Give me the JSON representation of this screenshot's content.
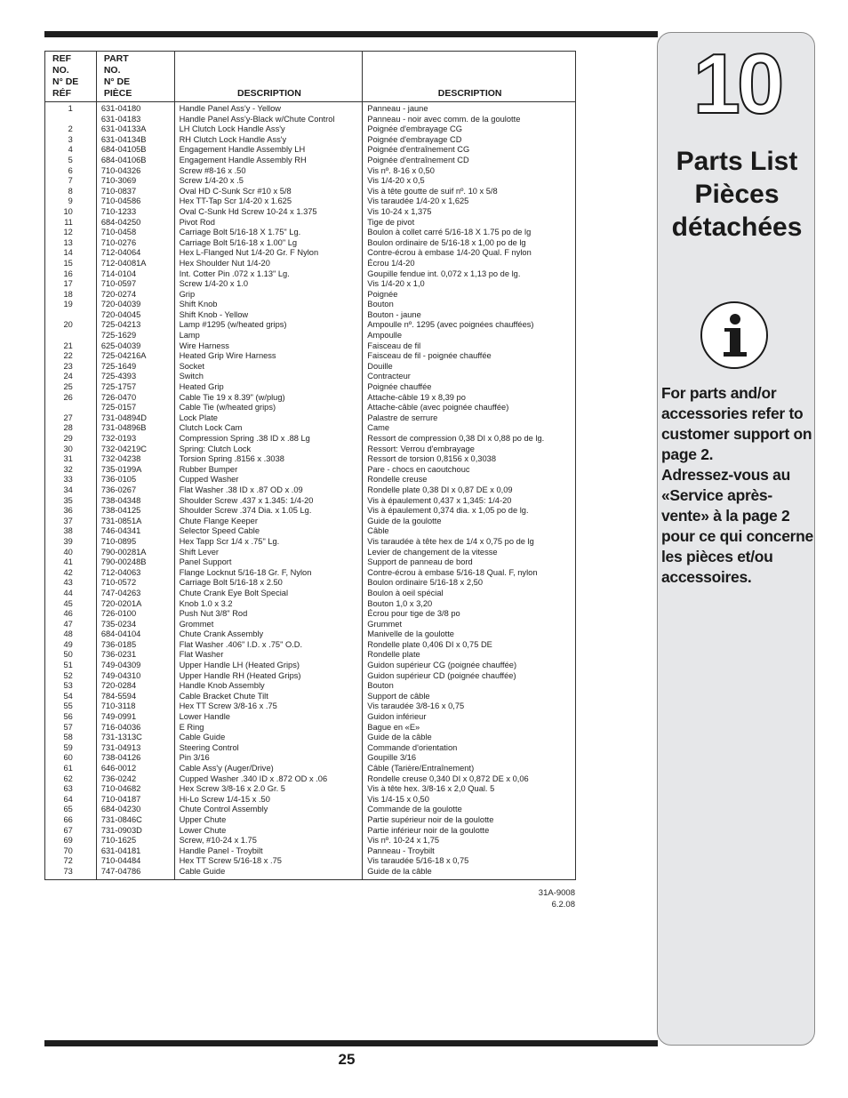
{
  "page": {
    "chapter_number": "10",
    "section_title_en": "Parts List",
    "section_title_fr_1": "Pièces",
    "section_title_fr_2": "détachées",
    "note_en": "For parts and/or accessories refer to customer support on page 2.",
    "note_fr": "Adressez-vous au «Service après-vente» à la page 2 pour ce qui concerne les pièces et/ou accessoires.",
    "page_number": "25",
    "doc_code": "31A-9008",
    "doc_date": "6.2.08",
    "info_icon": "info-icon"
  },
  "table": {
    "headers": {
      "ref": [
        "REF",
        "NO.",
        "N° DE",
        "RÉF"
      ],
      "part": [
        "PART",
        "NO.",
        "N° DE",
        "PIÈCE"
      ],
      "desc_en": "DESCRIPTION",
      "desc_fr": "DESCRIPTION"
    },
    "rows": [
      {
        "ref": "1",
        "part": "631-04180",
        "en": "Handle Panel Ass'y - Yellow",
        "fr": "Panneau - jaune"
      },
      {
        "ref": "",
        "part": "631-04183",
        "en": "Handle Panel Ass'y-Black w/Chute Control",
        "fr": "Panneau - noir avec comm. de la goulotte"
      },
      {
        "ref": "2",
        "part": "631-04133A",
        "en": "LH Clutch Lock Handle Ass'y",
        "fr": "Poignée d'embrayage CG"
      },
      {
        "ref": "3",
        "part": "631-04134B",
        "en": "RH Clutch Lock Handle Ass'y",
        "fr": "Poignée d'embrayage CD"
      },
      {
        "ref": "4",
        "part": "684-04105B",
        "en": "Engagement Handle Assembly LH",
        "fr": "Poignée d'entraînement CG"
      },
      {
        "ref": "5",
        "part": "684-04106B",
        "en": "Engagement Handle Assembly RH",
        "fr": "Poignée d'entraînement CD"
      },
      {
        "ref": "6",
        "part": "710-04326",
        "en": "Screw #8-16 x .50",
        "fr": "Vis nº. 8-16 x 0,50"
      },
      {
        "ref": "7",
        "part": "710-3069",
        "en": "Screw 1/4-20 x .5",
        "fr": "Vis 1/4-20 x 0,5"
      },
      {
        "ref": "8",
        "part": "710-0837",
        "en": "Oval HD C-Sunk Scr #10 x 5/8",
        "fr": "Vis à tête goutte de suif nº. 10 x 5/8"
      },
      {
        "ref": "9",
        "part": "710-04586",
        "en": "Hex TT-Tap Scr 1/4-20 x 1.625",
        "fr": "Vis taraudée 1/4-20 x 1,625"
      },
      {
        "ref": "10",
        "part": "710-1233",
        "en": "Oval C-Sunk Hd Screw 10-24 x 1.375",
        "fr": "Vis 10-24 x 1,375"
      },
      {
        "ref": "11",
        "part": "684-04250",
        "en": "Pivot Rod",
        "fr": "Tige de pivot"
      },
      {
        "ref": "12",
        "part": "710-0458",
        "en": "Carriage Bolt 5/16-18 X 1.75\" Lg.",
        "fr": "Boulon à collet carré 5/16-18 X 1.75 po de lg"
      },
      {
        "ref": "13",
        "part": "710-0276",
        "en": "Carriage Bolt 5/16-18 x 1.00\" Lg",
        "fr": "Boulon ordinaire de 5/16-18 x 1,00 po de lg"
      },
      {
        "ref": "14",
        "part": "712-04064",
        "en": "Hex L-Flanged Nut 1/4-20 Gr. F Nylon",
        "fr": "Contre-écrou à embase 1/4-20 Qual. F nylon"
      },
      {
        "ref": "15",
        "part": "712-04081A",
        "en": "Hex Shoulder Nut 1/4-20",
        "fr": "Écrou 1/4-20"
      },
      {
        "ref": "16",
        "part": "714-0104",
        "en": "Int. Cotter Pin .072 x 1.13\" Lg.",
        "fr": "Goupille fendue int. 0,072 x 1,13 po de lg."
      },
      {
        "ref": "17",
        "part": "710-0597",
        "en": "Screw 1/4-20 x 1.0",
        "fr": "Vis 1/4-20 x 1,0"
      },
      {
        "ref": "18",
        "part": "720-0274",
        "en": "Grip",
        "fr": "Poignée"
      },
      {
        "ref": "19",
        "part": "720-04039",
        "en": "Shift Knob",
        "fr": "Bouton"
      },
      {
        "ref": "",
        "part": "720-04045",
        "en": "Shift Knob - Yellow",
        "fr": "Bouton - jaune"
      },
      {
        "ref": "20",
        "part": "725-04213",
        "en": "Lamp #1295 (w/heated grips)",
        "fr": "Ampoulle nº. 1295 (avec poignées chauffées)"
      },
      {
        "ref": "",
        "part": "725-1629",
        "en": "Lamp",
        "fr": "Ampoulle"
      },
      {
        "ref": "21",
        "part": "625-04039",
        "en": "Wire Harness",
        "fr": "Faisceau de fil"
      },
      {
        "ref": "22",
        "part": "725-04216A",
        "en": "Heated Grip Wire Harness",
        "fr": "Faisceau de fil - poignée chauffée"
      },
      {
        "ref": "23",
        "part": "725-1649",
        "en": "Socket",
        "fr": "Douille"
      },
      {
        "ref": "24",
        "part": "725-4393",
        "en": "Switch",
        "fr": "Contracteur"
      },
      {
        "ref": "25",
        "part": "725-1757",
        "en": "Heated Grip",
        "fr": "Poignée chauffée"
      },
      {
        "ref": "26",
        "part": "726-0470",
        "en": "Cable Tie 19 x 8.39\" (w/plug)",
        "fr": "Attache-câble 19 x 8,39 po"
      },
      {
        "ref": "",
        "part": "725-0157",
        "en": "Cable Tie (w/heated grips)",
        "fr": "Attache-câble (avec poignée chauffée)"
      },
      {
        "ref": "27",
        "part": "731-04894D",
        "en": "Lock Plate",
        "fr": "Palastre de serrure"
      },
      {
        "ref": "28",
        "part": "731-04896B",
        "en": "Clutch Lock Cam",
        "fr": "Came"
      },
      {
        "ref": "29",
        "part": "732-0193",
        "en": "Compression Spring .38 ID x .88 Lg",
        "fr": "Ressort de compression 0,38 DI x 0,88 po de lg."
      },
      {
        "ref": "30",
        "part": "732-04219C",
        "en": "Spring: Clutch Lock",
        "fr": "Ressort: Verrou d'embrayage"
      },
      {
        "ref": "31",
        "part": "732-04238",
        "en": "Torsion Spring .8156 x .3038",
        "fr": "Ressort de torsion 0,8156 x 0,3038"
      },
      {
        "ref": "32",
        "part": "735-0199A",
        "en": "Rubber Bumper",
        "fr": "Pare - chocs en caoutchouc"
      },
      {
        "ref": "33",
        "part": "736-0105",
        "en": "Cupped Washer",
        "fr": "Rondelle creuse"
      },
      {
        "ref": "34",
        "part": "736-0267",
        "en": "Flat Washer .38 ID x .87 OD x .09",
        "fr": "Rondelle plate 0,38 DI x 0,87 DE x 0,09"
      },
      {
        "ref": "35",
        "part": "738-04348",
        "en": "Shoulder Screw .437 x 1.345: 1/4-20",
        "fr": "Vis à épaulement 0,437 x 1,345: 1/4-20"
      },
      {
        "ref": "36",
        "part": "738-04125",
        "en": "Shoulder Screw .374 Dia. x 1.05 Lg.",
        "fr": "Vis à épaulement 0,374 dia. x 1,05 po de lg."
      },
      {
        "ref": "37",
        "part": "731-0851A",
        "en": "Chute Flange Keeper",
        "fr": "Guide de la goulotte"
      },
      {
        "ref": "38",
        "part": "746-04341",
        "en": "Selector Speed Cable",
        "fr": "Câble"
      },
      {
        "ref": "39",
        "part": "710-0895",
        "en": "Hex Tapp Scr 1/4 x .75\" Lg.",
        "fr": "Vis taraudée à tête hex de 1/4 x 0,75 po de lg"
      },
      {
        "ref": "40",
        "part": "790-00281A",
        "en": "Shift Lever",
        "fr": "Levier de changement de la vitesse"
      },
      {
        "ref": "41",
        "part": "790-00248B",
        "en": "Panel Support",
        "fr": "Support de panneau de bord"
      },
      {
        "ref": "42",
        "part": "712-04063",
        "en": "Flange Locknut 5/16-18 Gr. F, Nylon",
        "fr": "Contre-écrou à embase 5/16-18 Qual. F, nylon"
      },
      {
        "ref": "43",
        "part": "710-0572",
        "en": "Carriage Bolt 5/16-18 x 2.50",
        "fr": "Boulon ordinaire 5/16-18 x 2,50"
      },
      {
        "ref": "44",
        "part": "747-04263",
        "en": "Chute Crank Eye Bolt Special",
        "fr": "Boulon à oeil spécial"
      },
      {
        "ref": "45",
        "part": "720-0201A",
        "en": "Knob 1.0 x 3.2",
        "fr": "Bouton 1,0 x 3,20"
      },
      {
        "ref": "46",
        "part": "726-0100",
        "en": "Push Nut 3/8\" Rod",
        "fr": "Écrou pour tige de 3/8 po"
      },
      {
        "ref": "47",
        "part": "735-0234",
        "en": "Grommet",
        "fr": "Grummet"
      },
      {
        "ref": "48",
        "part": "684-04104",
        "en": "Chute Crank Assembly",
        "fr": "Manivelle de la goulotte"
      },
      {
        "ref": "49",
        "part": "736-0185",
        "en": "Flat Washer .406\" I.D. x .75\" O.D.",
        "fr": "Rondelle plate 0,406 DI x 0,75 DE"
      },
      {
        "ref": "50",
        "part": "736-0231",
        "en": "Flat Washer",
        "fr": "Rondelle plate"
      },
      {
        "ref": "51",
        "part": "749-04309",
        "en": "Upper Handle LH (Heated Grips)",
        "fr": "Guidon supérieur CG (poignée chauffée)"
      },
      {
        "ref": "52",
        "part": "749-04310",
        "en": "Upper Handle RH (Heated Grips)",
        "fr": "Guidon supérieur CD (poignée chauffée)"
      },
      {
        "ref": "53",
        "part": "720-0284",
        "en": "Handle Knob Assembly",
        "fr": "Bouton"
      },
      {
        "ref": "54",
        "part": "784-5594",
        "en": "Cable Bracket Chute Tilt",
        "fr": "Support de câble"
      },
      {
        "ref": "55",
        "part": "710-3118",
        "en": "Hex TT Screw 3/8-16 x .75",
        "fr": "Vis taraudée 3/8-16 x 0,75"
      },
      {
        "ref": "56",
        "part": "749-0991",
        "en": "Lower Handle",
        "fr": "Guidon inférieur"
      },
      {
        "ref": "57",
        "part": "716-04036",
        "en": "E Ring",
        "fr": "Bague en «E»"
      },
      {
        "ref": "58",
        "part": "731-1313C",
        "en": "Cable Guide",
        "fr": "Guide de la câble"
      },
      {
        "ref": "59",
        "part": "731-04913",
        "en": "Steering Control",
        "fr": "Commande d'orientation"
      },
      {
        "ref": "60",
        "part": "738-04126",
        "en": "Pin 3/16",
        "fr": "Goupille 3/16"
      },
      {
        "ref": "61",
        "part": "646-0012",
        "en": "Cable Ass'y (Auger/Drive)",
        "fr": "Câble (Tarière/Entraînement)"
      },
      {
        "ref": "62",
        "part": "736-0242",
        "en": "Cupped Washer .340 ID x .872 OD x .06",
        "fr": "Rondelle creuse 0,340 DI x 0,872 DE x 0,06"
      },
      {
        "ref": "63",
        "part": "710-04682",
        "en": "Hex Screw 3/8-16 x 2.0 Gr. 5",
        "fr": "Vis à tête hex. 3/8-16 x 2,0 Qual. 5"
      },
      {
        "ref": "64",
        "part": "710-04187",
        "en": "Hi-Lo Screw 1/4-15 x .50",
        "fr": "Vis 1/4-15 x 0,50"
      },
      {
        "ref": "65",
        "part": "684-04230",
        "en": "Chute Control Assembly",
        "fr": "Commande de la goulotte"
      },
      {
        "ref": "66",
        "part": "731-0846C",
        "en": "Upper Chute",
        "fr": "Partie supérieur noir de la goulotte"
      },
      {
        "ref": "67",
        "part": "731-0903D",
        "en": "Lower Chute",
        "fr": "Partie inférieur noir de la goulotte"
      },
      {
        "ref": "69",
        "part": "710-1625",
        "en": "Screw, #10-24 x 1.75",
        "fr": "Vis nº. 10-24 x 1,75"
      },
      {
        "ref": "70",
        "part": "631-04181",
        "en": "Handle Panel - Troybilt",
        "fr": "Panneau - Troybilt"
      },
      {
        "ref": "72",
        "part": "710-04484",
        "en": "Hex TT Screw 5/16-18  x .75",
        "fr": "Vis taraudée 5/16-18 x 0,75"
      },
      {
        "ref": "73",
        "part": "747-04786",
        "en": "Cable Guide",
        "fr": "Guide de la câble"
      }
    ]
  }
}
